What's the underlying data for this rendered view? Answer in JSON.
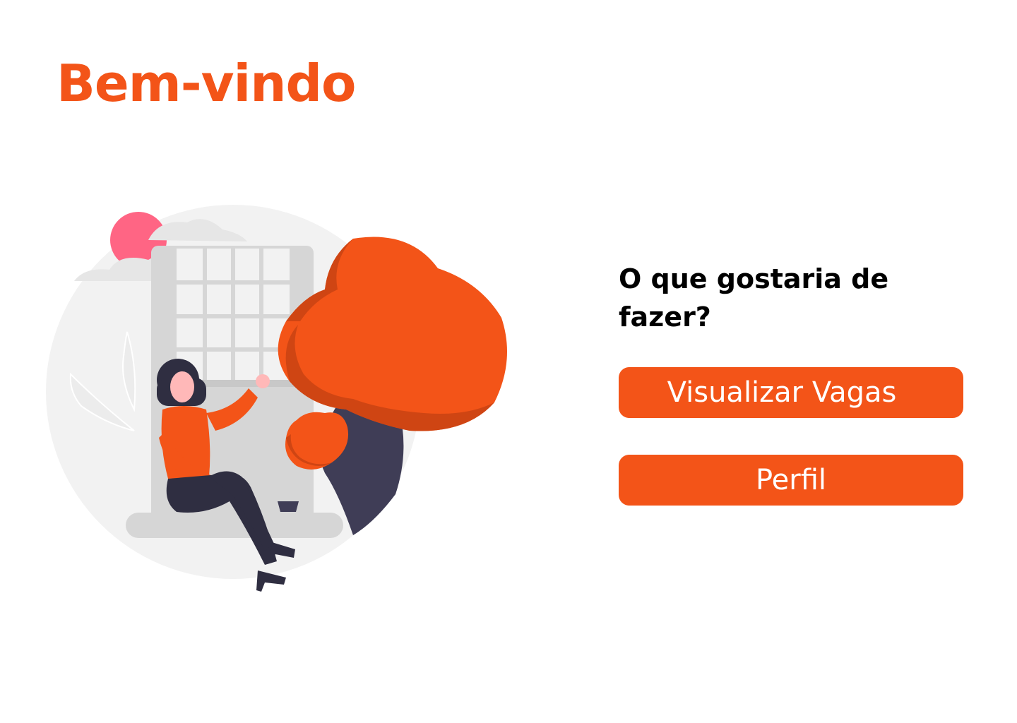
{
  "header": {
    "title": "Bem-vindo"
  },
  "illustration": {
    "name": "woman-sitting-by-window-with-tree",
    "colors": {
      "accent": "#F35418",
      "accent_dark": "#CF4513",
      "sun": "#FF6584",
      "circle": "#F2F2F2",
      "window": "#D6D6D6",
      "clothing_dark": "#2F2E41",
      "trunk": "#3F3D56"
    }
  },
  "menu": {
    "question": "O que gostaria de fazer?",
    "buttons": [
      {
        "label": "Visualizar Vagas"
      },
      {
        "label": "Perfil"
      }
    ]
  },
  "theme": {
    "primary": "#F35418",
    "background": "#FFFFFF",
    "text": "#000000",
    "button_text": "#FFFFFF"
  }
}
